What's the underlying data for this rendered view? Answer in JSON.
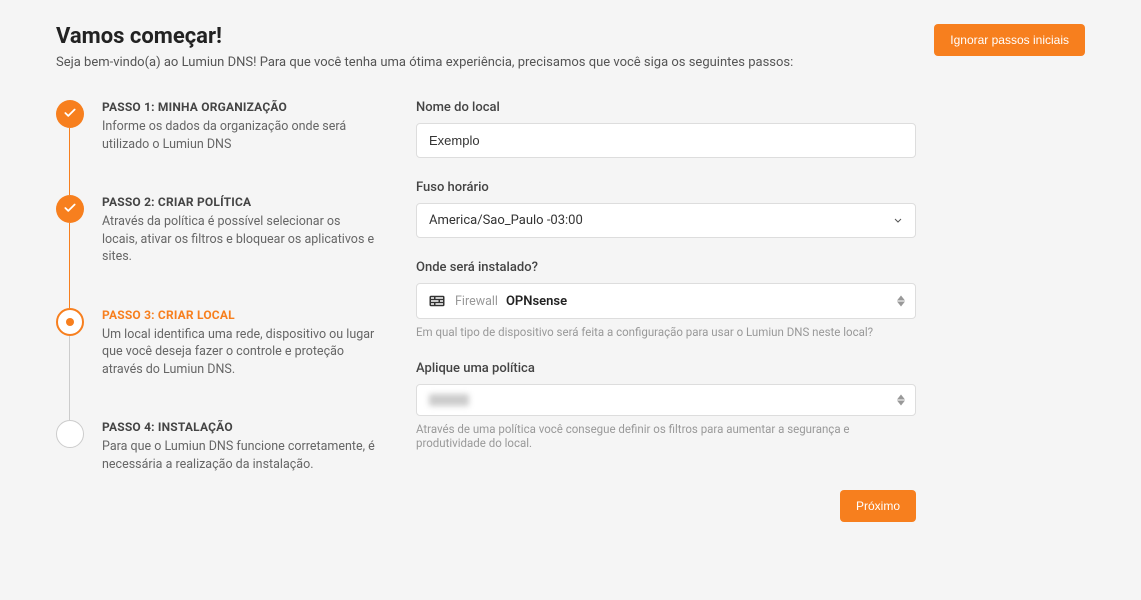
{
  "header": {
    "title": "Vamos começar!",
    "subtitle": "Seja bem-vindo(a) ao Lumiun DNS! Para que você tenha uma ótima experiência, precisamos que você siga os seguintes passos:",
    "skip_button": "Ignorar passos iniciais"
  },
  "steps": [
    {
      "title": "PASSO 1: MINHA ORGANIZAÇÃO",
      "desc": "Informe os dados da organização onde será utilizado o Lumiun DNS",
      "state": "done"
    },
    {
      "title": "PASSO 2: CRIAR POLÍTICA",
      "desc": "Através da política é possível selecionar os locais, ativar os filtros e bloquear os aplicativos e sites.",
      "state": "done"
    },
    {
      "title": "PASSO 3: CRIAR LOCAL",
      "desc": "Um local identifica uma rede, dispositivo ou lugar que você deseja fazer o controle e proteção através do Lumiun DNS.",
      "state": "active"
    },
    {
      "title": "PASSO 4: INSTALAÇÃO",
      "desc": "Para que o Lumiun DNS funcione corretamente, é necessária a realização da instalação.",
      "state": "pending"
    }
  ],
  "form": {
    "name_label": "Nome do local",
    "name_value": "Exemplo",
    "tz_label": "Fuso horário",
    "tz_value": "America/Sao_Paulo -03:00",
    "install_label": "Onde será instalado?",
    "install_category": "Firewall",
    "install_value": "OPNsense",
    "install_helper": "Em qual tipo de dispositivo será feita a configuração para usar o Lumiun DNS neste local?",
    "policy_label": "Aplique uma política",
    "policy_helper": "Através de uma política você consegue definir os filtros para aumentar a segurança e produtividade do local."
  },
  "footer": {
    "next": "Próximo"
  }
}
